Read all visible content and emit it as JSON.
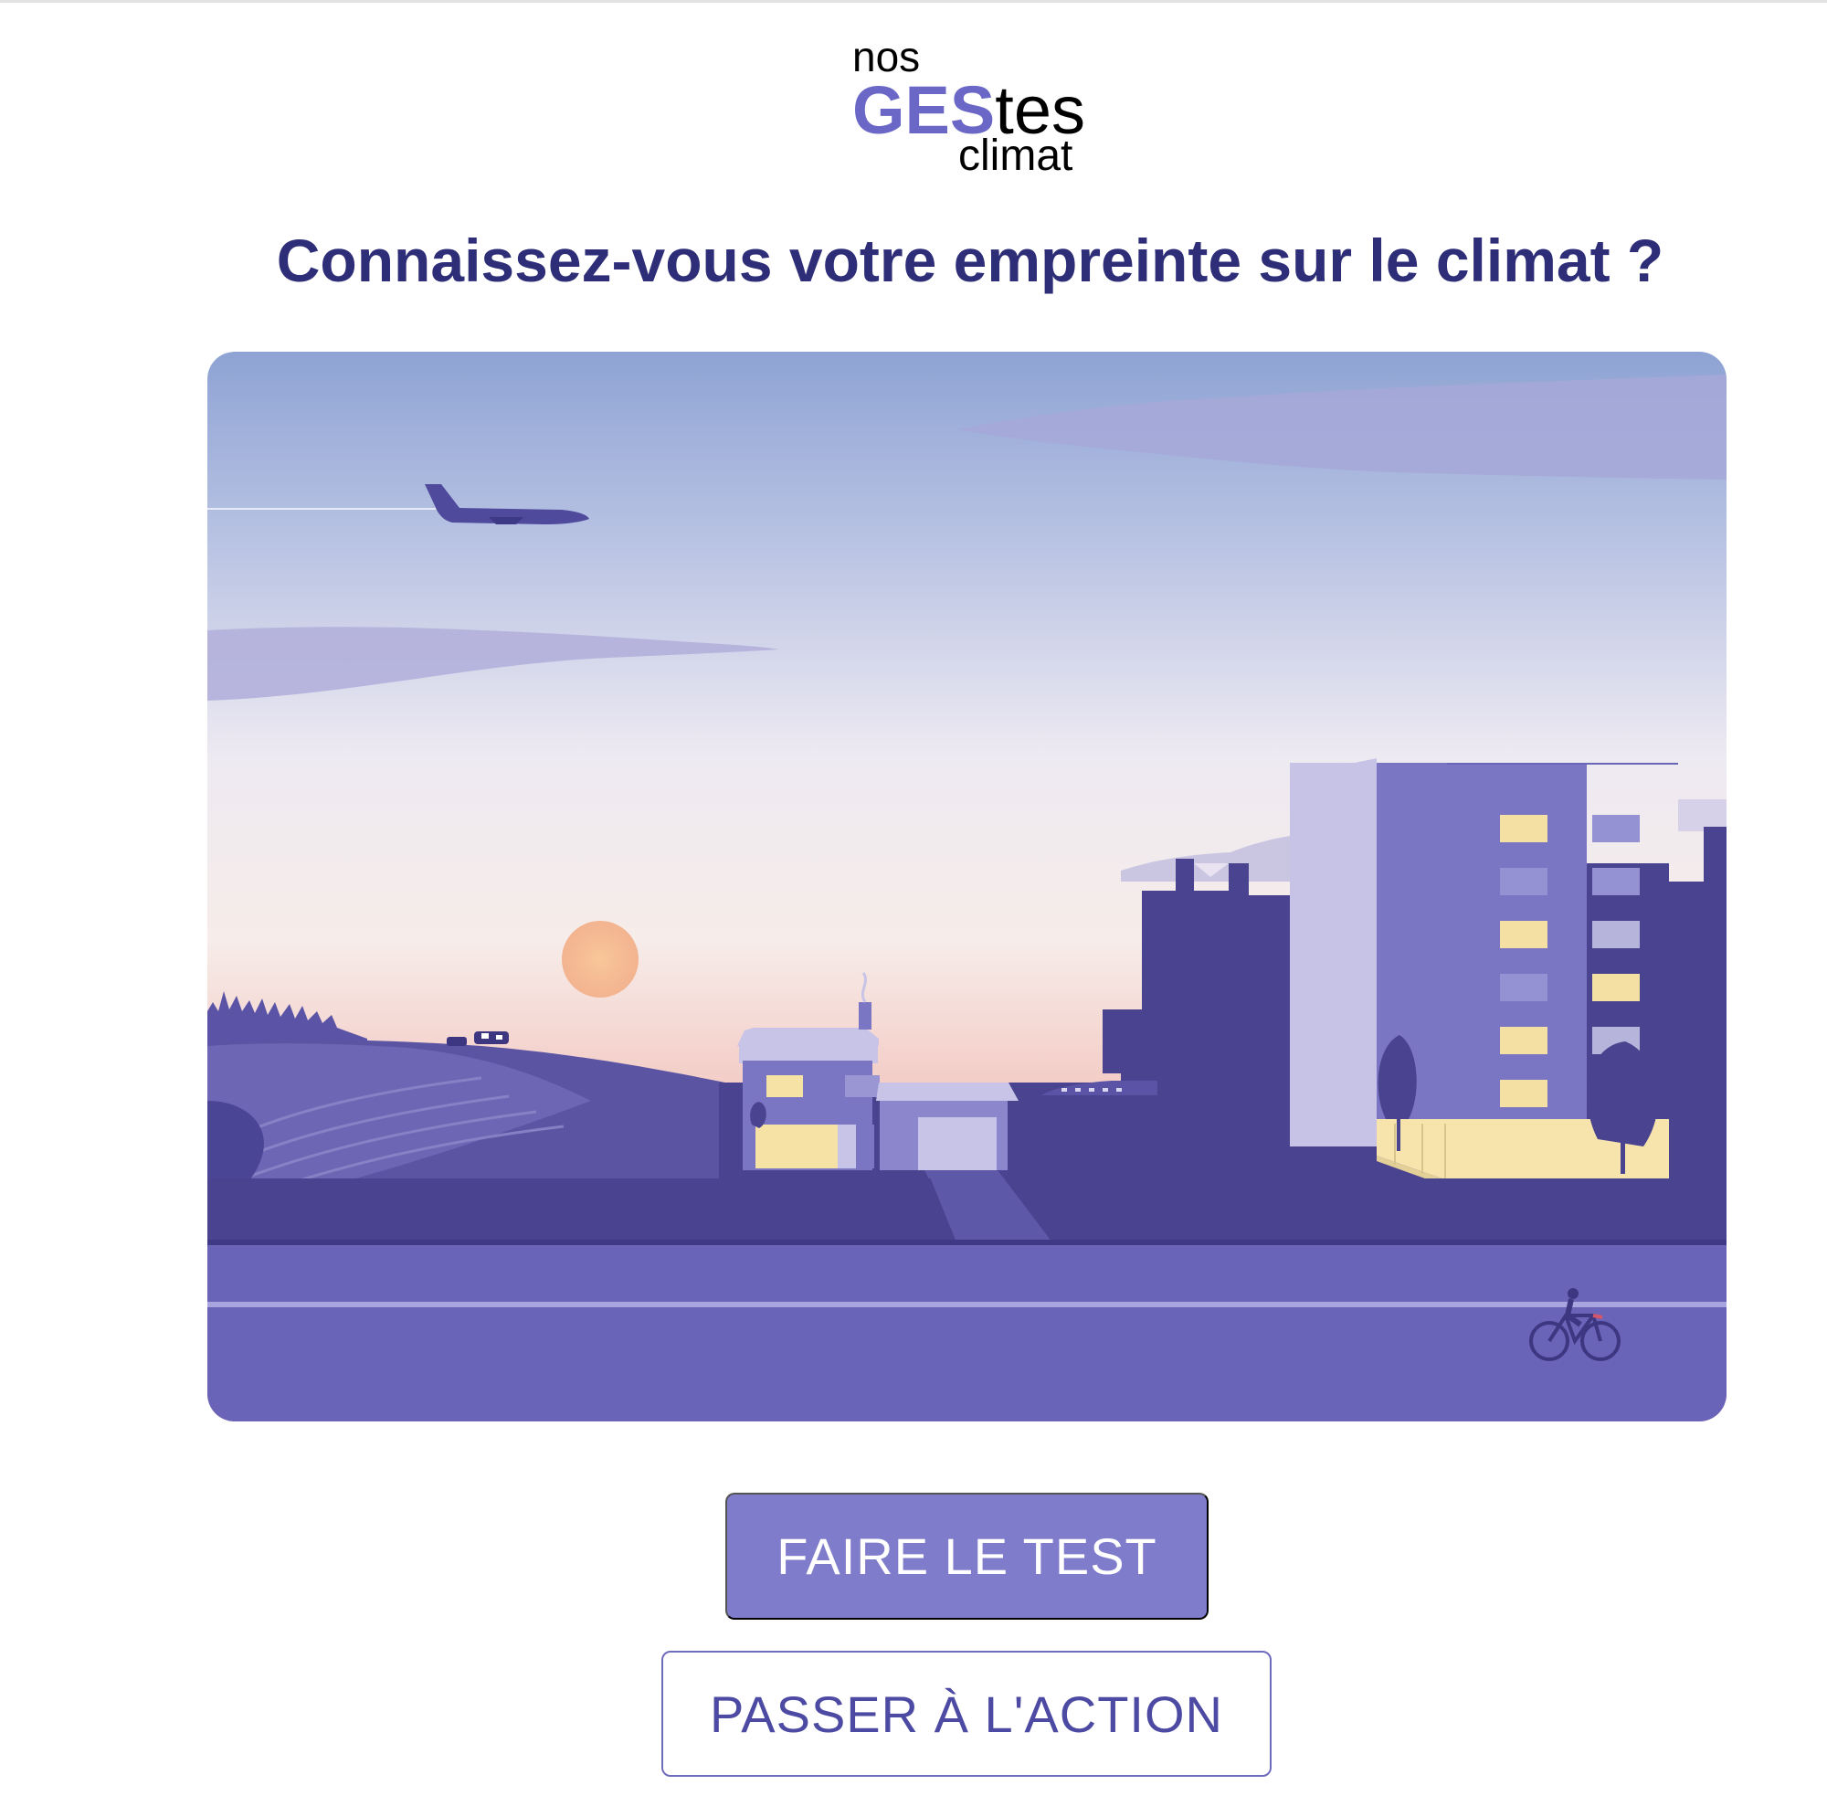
{
  "logo": {
    "line1": "nos",
    "highlight": "GES",
    "rest": "tes",
    "line3": "climat"
  },
  "headline": "Connaissez-vous votre empreinte sur le climat ?",
  "buttons": {
    "primary_label": "FAIRE LE TEST",
    "secondary_label": "PASSER À L'ACTION"
  },
  "colors": {
    "accent": "#6a67c6",
    "headline": "#2e2d78",
    "primary_button": "#7f7ccc",
    "secondary_button_text": "#4c4aa3"
  }
}
